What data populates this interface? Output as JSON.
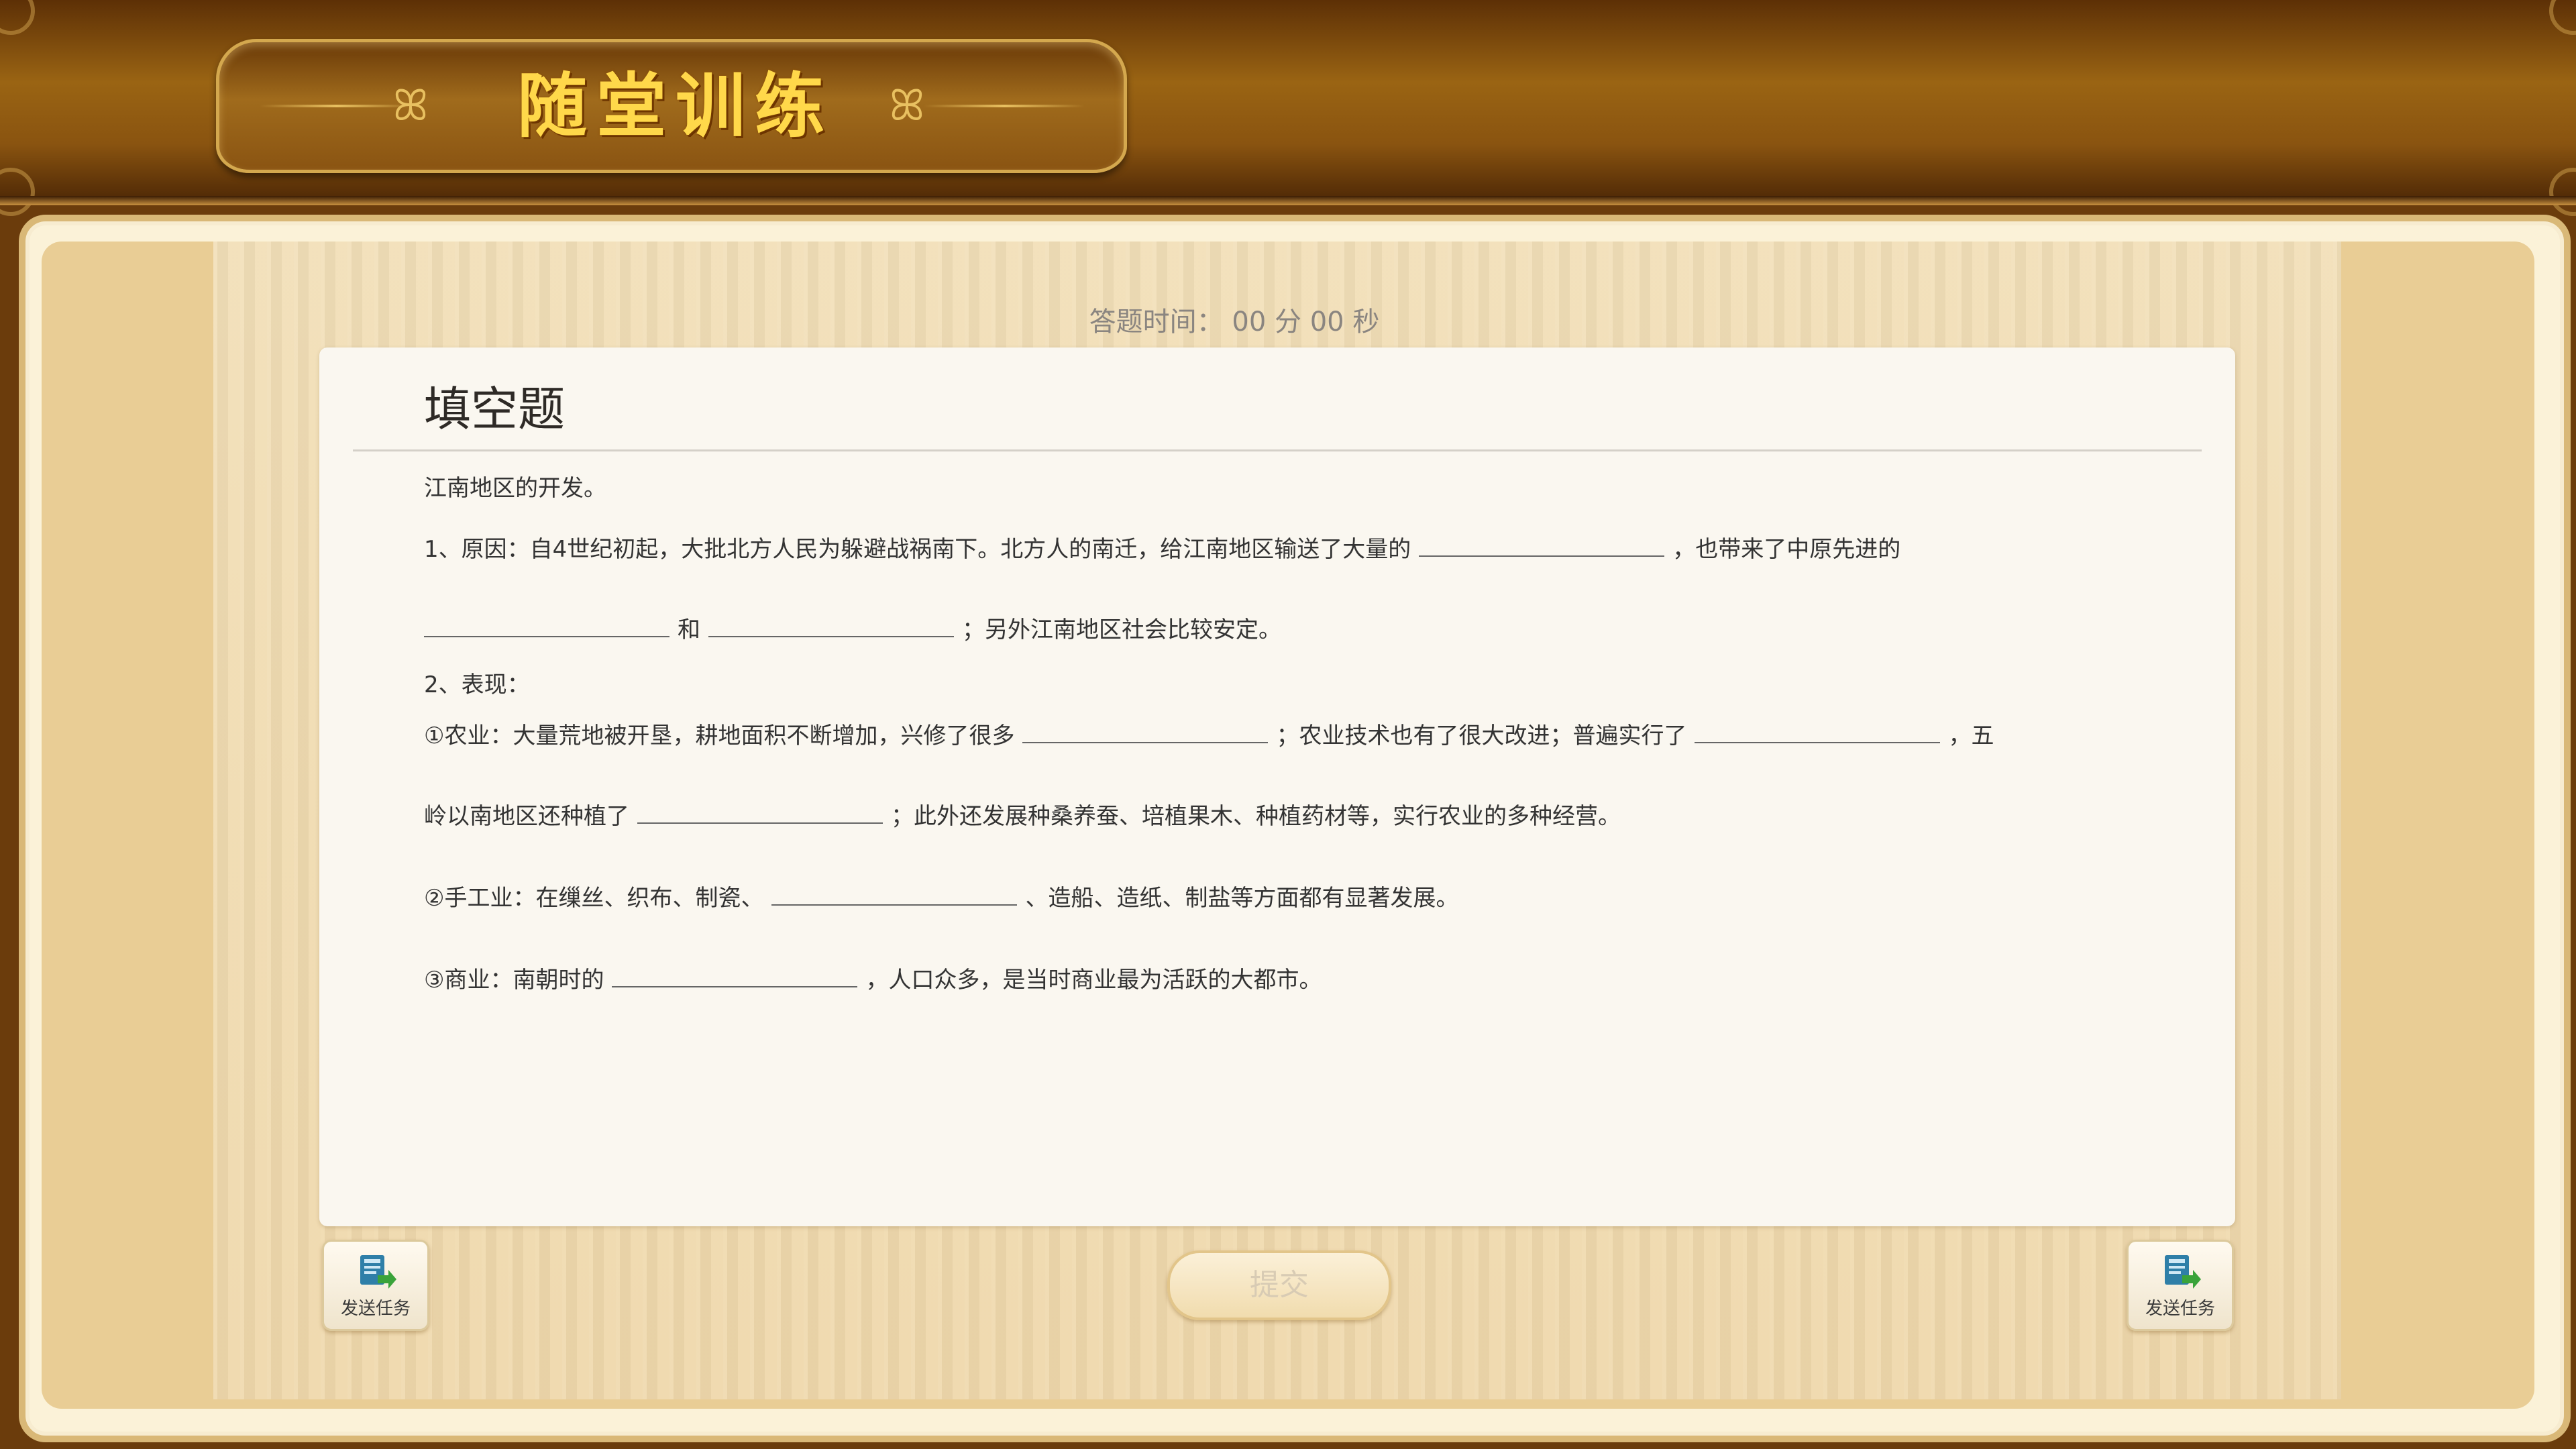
{
  "header": {
    "title": "随堂训练",
    "ornament_left": "ꕤ",
    "ornament_right": "ꕤ"
  },
  "timer": {
    "text": "答题时间： 00 分 00 秒"
  },
  "question": {
    "type_title": "填空题",
    "intro": "江南地区的开发。",
    "item1": {
      "part_a": "1、原因：自4世纪初起，大批北方人民为躲避战祸南下。北方人的南迁，给江南地区输送了大量的",
      "part_b": "，也带来了中原先进的",
      "part_c": "和",
      "part_d": "；另外江南地区社会比较安定。"
    },
    "item2_heading": "2、表现：",
    "agri": {
      "part_a": "①农业：大量荒地被开垦，耕地面积不断增加，兴修了很多",
      "part_b": "；农业技术也有了很大改进；普遍实行了",
      "part_c": "，五",
      "part_d": "岭以南地区还种植了",
      "part_e": "；此外还发展种桑养蚕、培植果木、种植药材等，实行农业的多种经营。"
    },
    "craft": {
      "part_a": "②手工业：在缫丝、织布、制瓷、",
      "part_b": "、造船、造纸、制盐等方面都有显著发展。"
    },
    "commerce": {
      "part_a": "③商业：南朝时的",
      "part_b": "，人口众多，是当时商业最为活跃的大都市。"
    }
  },
  "controls": {
    "submit_label": "提交",
    "send_task_left": "发送任务",
    "send_task_right": "发送任务"
  },
  "colors": {
    "title_gold": "#ffd84a",
    "header_brown": "#8a5410",
    "wood_bg": "#f0dbb0",
    "card_bg": "#faf7f0"
  }
}
